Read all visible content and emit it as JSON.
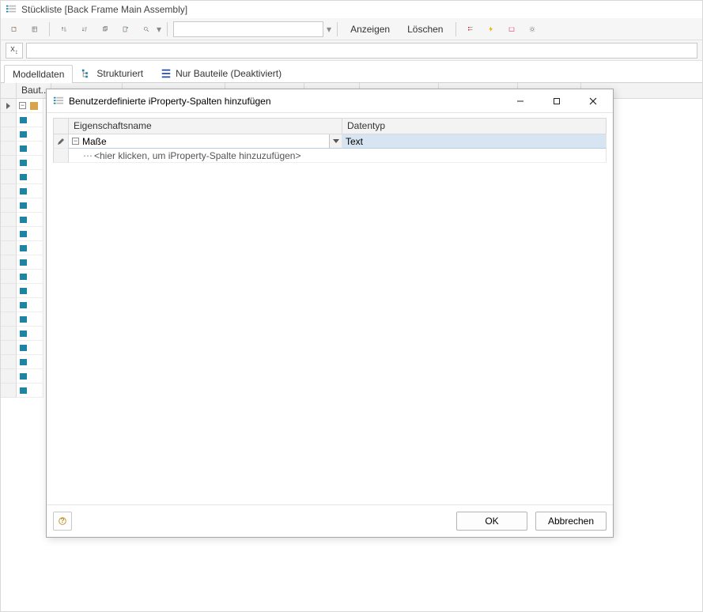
{
  "window": {
    "title": "Stückliste [Back Frame Main Assembly]"
  },
  "toolbar": {
    "show_label": "Anzeigen",
    "clear_label": "Löschen"
  },
  "tabs": {
    "modeldata": "Modelldaten",
    "structured": "Strukturiert",
    "parts_only": "Nur Bauteile (Deaktiviert)"
  },
  "grid": {
    "headers": [
      "Baut..."
    ]
  },
  "dialog": {
    "title": "Benutzerdefinierte iProperty-Spalten hinzufügen",
    "columns": {
      "name": "Eigenschaftsname",
      "type": "Datentyp"
    },
    "row1": {
      "name": "Maße",
      "type": "Text"
    },
    "placeholder": "<hier klicken, um iProperty-Spalte hinzuzufügen>",
    "ok": "OK",
    "cancel": "Abbrechen"
  }
}
